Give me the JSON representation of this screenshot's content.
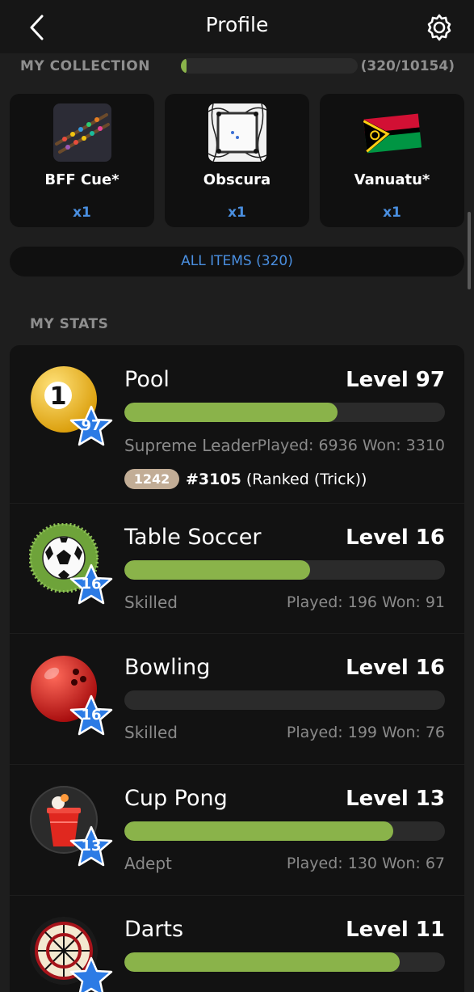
{
  "header": {
    "title": "Profile",
    "back_icon": "chevron-left-icon",
    "settings_icon": "gear-icon"
  },
  "collection": {
    "title": "MY COLLECTION",
    "count": "(320/10154)",
    "progress": 0.03,
    "items": [
      {
        "name": "BFF Cue*",
        "qty": "x1",
        "icon": "cue-icon"
      },
      {
        "name": "Obscura",
        "qty": "x1",
        "icon": "table-icon"
      },
      {
        "name": "Vanuatu*",
        "qty": "x1",
        "icon": "vanuatu-flag-icon"
      }
    ],
    "all_items_label": "ALL ITEMS (320)"
  },
  "stats": {
    "title": "MY STATS",
    "games": [
      {
        "name": "Pool",
        "level": "Level 97",
        "star": "97",
        "progress": 0.665,
        "rank": "Supreme Leader",
        "played": "Played: 6936 Won: 3310",
        "rating": "1242",
        "rank_pos": "#3105",
        "rank_mode": " (Ranked (Trick))"
      },
      {
        "name": "Table Soccer",
        "level": "Level 16",
        "star": "16",
        "progress": 0.58,
        "rank": "Skilled",
        "played": "Played: 196 Won: 91"
      },
      {
        "name": "Bowling",
        "level": "Level 16",
        "star": "16",
        "progress": 0.0,
        "rank": "Skilled",
        "played": "Played: 199 Won: 76"
      },
      {
        "name": "Cup Pong",
        "level": "Level 13",
        "star": "13",
        "progress": 0.84,
        "rank": "Adept",
        "played": "Played: 130 Won: 67"
      },
      {
        "name": "Darts",
        "level": "Level 11",
        "star": "",
        "progress": 0.86,
        "rank": "",
        "played": ""
      }
    ]
  },
  "colors": {
    "accent_blue": "#4a8fe0",
    "progress_green": "#8ab34a",
    "rating_badge": "#c2ad96"
  }
}
